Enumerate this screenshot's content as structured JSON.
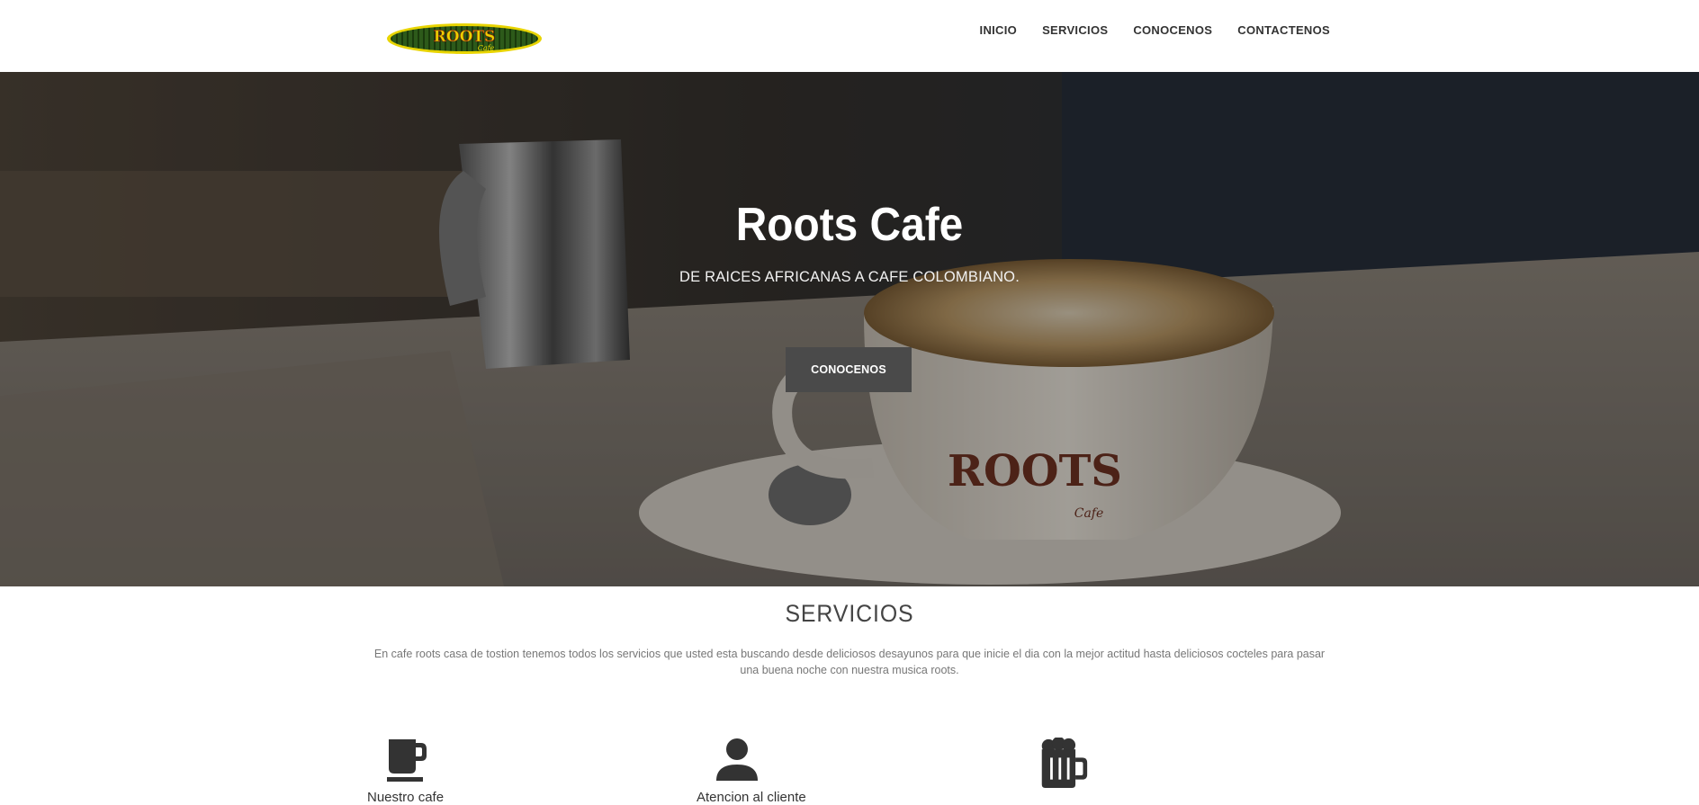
{
  "nav": {
    "logo_alt": "Roots Cafe logo",
    "links": [
      "INICIO",
      "SERVICIOS",
      "CONOCENOS",
      "CONTACTENOS"
    ]
  },
  "hero": {
    "title": "Roots Cafe",
    "subtitle": "DE RAICES AFRICANAS A CAFE COLOMBIANO.",
    "button_label": "CONOCENOS"
  },
  "services": {
    "title": "SERVICIOS",
    "description": "En cafe roots casa de tostion tenemos todos los servicios que usted esta buscando desde deliciosos desayunos para que inicie el dia con la mejor actitud hasta deliciosos cocteles para pasar una buena noche con nuestra musica roots.",
    "items": [
      {
        "icon": "coffee-cup-icon",
        "label": "Nuestro cafe"
      },
      {
        "icon": "person-icon",
        "label": "Atencion al cliente"
      },
      {
        "icon": "beer-mug-icon",
        "label": ""
      }
    ]
  },
  "colors": {
    "button_bg": "#4a4a4a",
    "icon_color": "#333333"
  }
}
